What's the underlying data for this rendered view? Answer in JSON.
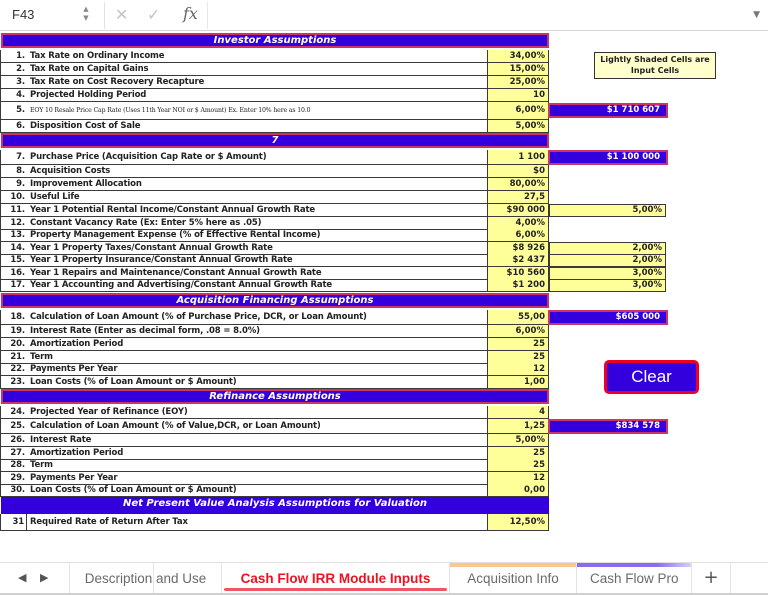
{
  "formula_bar": {
    "cell_ref": "F43",
    "stepper_up": "▲",
    "stepper_down": "▼",
    "cancel_icon": "✕",
    "confirm_icon": "✓",
    "fx_label": "fx",
    "formula_value": "",
    "dropdown_icon": "▼"
  },
  "sections": {
    "investor": "Investor Assumptions",
    "property": "7",
    "financing": "Acquisition Financing Assumptions",
    "refinance": "Refinance Assumptions",
    "npv": "Net Present Value Analysis Assumptions for Valuation"
  },
  "rows": [
    {
      "num": "1.",
      "label": "Tax Rate on Ordinary Income",
      "value": "34,00%"
    },
    {
      "num": "2.",
      "label": "Tax Rate on Capital Gains",
      "value": "15,00%"
    },
    {
      "num": "3.",
      "label": "Tax Rate on Cost Recovery Recapture",
      "value": "25,00%"
    },
    {
      "num": "4.",
      "label": "Projected Holding Period",
      "value": "10"
    },
    {
      "num": "5.",
      "label": "EOY 10 Resale Price Cap Rate (Uses 11th Year NOI or $ Amount) Ex. Enter 10% here as 10.0",
      "value": "6,00%"
    },
    {
      "num": "6.",
      "label": "Disposition Cost of Sale",
      "value": "5,00%"
    },
    {
      "num": "7.",
      "label": "Purchase Price (Acquisition Cap Rate or $ Amount)",
      "value": "1 100 000,00"
    },
    {
      "num": "8.",
      "label": "Acquisition Costs",
      "value": "$0"
    },
    {
      "num": "9.",
      "label": "Improvement Allocation",
      "value": "80,00%"
    },
    {
      "num": "10.",
      "label": "Useful Life",
      "value": "27,5"
    },
    {
      "num": "11.",
      "label": "Year 1 Potential Rental Income/Constant Annual Growth Rate",
      "value": "$90 000"
    },
    {
      "num": "12.",
      "label": "Constant Vacancy Rate (Ex: Enter 5% here as .05)",
      "value": "4,00%"
    },
    {
      "num": "13.",
      "label": "Property Management Expense (% of Effective Rental Income)",
      "value": "6,00%"
    },
    {
      "num": "14.",
      "label": "Year 1 Property Taxes/Constant Annual Growth Rate",
      "value": "$8 926"
    },
    {
      "num": "15.",
      "label": "Year 1 Property Insurance/Constant Annual Growth Rate",
      "value": "$2 437"
    },
    {
      "num": "16.",
      "label": "Year 1 Repairs and Maintenance/Constant Annual Growth Rate",
      "value": "$10 560"
    },
    {
      "num": "17.",
      "label": "Year 1 Accounting and Advertising/Constant Annual Growth Rate",
      "value": "$1 200"
    },
    {
      "num": "18.",
      "label": "Calculation of Loan Amount (% of Purchase Price, DCR, or Loan Amount)",
      "value": "55,00"
    },
    {
      "num": "19.",
      "label": "Interest Rate (Enter as decimal form, .08 = 8.0%)",
      "value": "6,00%"
    },
    {
      "num": "20.",
      "label": "Amortization Period",
      "value": "25"
    },
    {
      "num": "21.",
      "label": "Term",
      "value": "25"
    },
    {
      "num": "22.",
      "label": "Payments Per Year",
      "value": "12"
    },
    {
      "num": "23.",
      "label": "Loan Costs (% of Loan Amount or $ Amount)",
      "value": "1,00"
    },
    {
      "num": "24.",
      "label": "Projected Year of Refinance (EOY)",
      "value": "4"
    },
    {
      "num": "25.",
      "label": "Calculation of Loan Amount (% of Value,DCR, or Loan Amount)",
      "value": "1,25"
    },
    {
      "num": "26.",
      "label": "Interest Rate",
      "value": "5,00%"
    },
    {
      "num": "27.",
      "label": "Amortization Period",
      "value": "25"
    },
    {
      "num": "28.",
      "label": "Term",
      "value": "25"
    },
    {
      "num": "29.",
      "label": "Payments Per Year",
      "value": "12"
    },
    {
      "num": "30.",
      "label": "Loan Costs (% of Loan Amount or $ Amount)",
      "value": "0,00"
    },
    {
      "num": "31",
      "label": "Required Rate of Return After Tax",
      "value": "12,50%"
    }
  ],
  "growth_rates": {
    "rental_income": "5,00%",
    "property_taxes": "2,00%",
    "property_insurance": "2,00%",
    "repairs": "3,00%",
    "accounting": "3,00%"
  },
  "calculated": {
    "resale_price": "$1 710 607",
    "purchase_price": "$1 100 000",
    "loan_amount": "$605 000",
    "refinance_loan_amount": "$834 578"
  },
  "note": {
    "line1": "Lightly Shaded Cells are",
    "line2": "Input Cells"
  },
  "clear_button": "Clear",
  "tabs": [
    {
      "label": "Description and Use",
      "active": false,
      "color": ""
    },
    {
      "label": "Cash Flow IRR Module Inputs",
      "active": true,
      "color": ""
    },
    {
      "label": "Acquisition Info",
      "active": false,
      "color": "#f8c98a"
    },
    {
      "label": "Cash Flow Pro",
      "active": false,
      "color": "#8a6cf0"
    }
  ],
  "tab_nav": {
    "prev": "◀",
    "next": "▶",
    "add": "+"
  },
  "colors": {
    "header_bg": "#3300dd",
    "header_border": "#cc3366",
    "input_cell": "#ffff99",
    "active_tab": "#ee1122",
    "clear_border": "#ee0022"
  }
}
